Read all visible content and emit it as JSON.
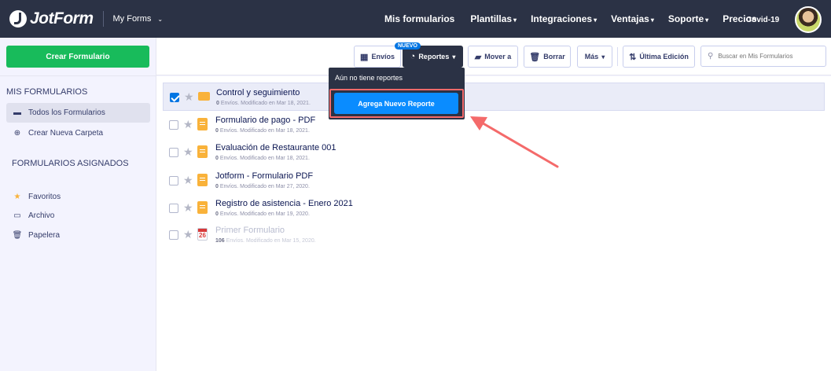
{
  "header": {
    "brand": "JotForm",
    "section": "My Forms",
    "nav": [
      {
        "label": "Mis formularios",
        "caret": ""
      },
      {
        "label": "Plantillas",
        "caret": "▾"
      },
      {
        "label": "Integraciones",
        "caret": "▾"
      },
      {
        "label": "Ventajas",
        "caret": "▾"
      },
      {
        "label": "Soporte",
        "caret": "▾"
      },
      {
        "label": "Precios",
        "caret": ""
      }
    ],
    "covid": "Covid-19"
  },
  "sidebar": {
    "create_label": "Crear Formulario",
    "section_mine": "MIS FORMULARIOS",
    "all_forms": "Todos los Formularios",
    "new_folder": "Crear Nueva Carpeta",
    "section_assigned": "FORMULARIOS ASIGNADOS",
    "favorites": "Favoritos",
    "archive": "Archivo",
    "trash": "Papelera"
  },
  "toolbar": {
    "envios": "Envíos",
    "nuevo_badge": "NUEVO",
    "reportes": "Reportes",
    "mover": "Mover a",
    "borrar": "Borrar",
    "mas": "Más",
    "ultima": "Última Edición",
    "search_placeholder": "Buscar en Mis Formularios"
  },
  "dropdown": {
    "message": "Aún no tiene reportes",
    "button": "Agrega Nuevo Reporte"
  },
  "forms": [
    {
      "title": "Control y seguimiento",
      "count": "0",
      "unit": "Envíos.",
      "modified": "Modificado en Mar 18, 2021.",
      "selected": true
    },
    {
      "title": "Formulario de pago - PDF",
      "count": "0",
      "unit": "Envíos.",
      "modified": "Modificado en Mar 18, 2021.",
      "selected": false
    },
    {
      "title": "Evaluación de Restaurante 001",
      "count": "0",
      "unit": "Envíos.",
      "modified": "Modificado en Mar 18, 2021.",
      "selected": false
    },
    {
      "title": "Jotform - Formulario PDF",
      "count": "0",
      "unit": "Envíos.",
      "modified": "Modificado en Mar 27, 2020.",
      "selected": false
    },
    {
      "title": "Registro de asistencia - Enero 2021",
      "count": "0",
      "unit": "Envíos.",
      "modified": "Modificado en Mar 19, 2020.",
      "selected": false
    },
    {
      "title": "Primer Formulario",
      "count": "106",
      "unit": "Envíos.",
      "modified": "Modificado en Mar 15, 2020.",
      "selected": false,
      "cal_day": "26"
    }
  ],
  "colors": {
    "nav_bg": "#2b3245",
    "create_green": "#18bb5b",
    "report_blue": "#0a8cff",
    "highlight_red": "#f46a6a"
  }
}
